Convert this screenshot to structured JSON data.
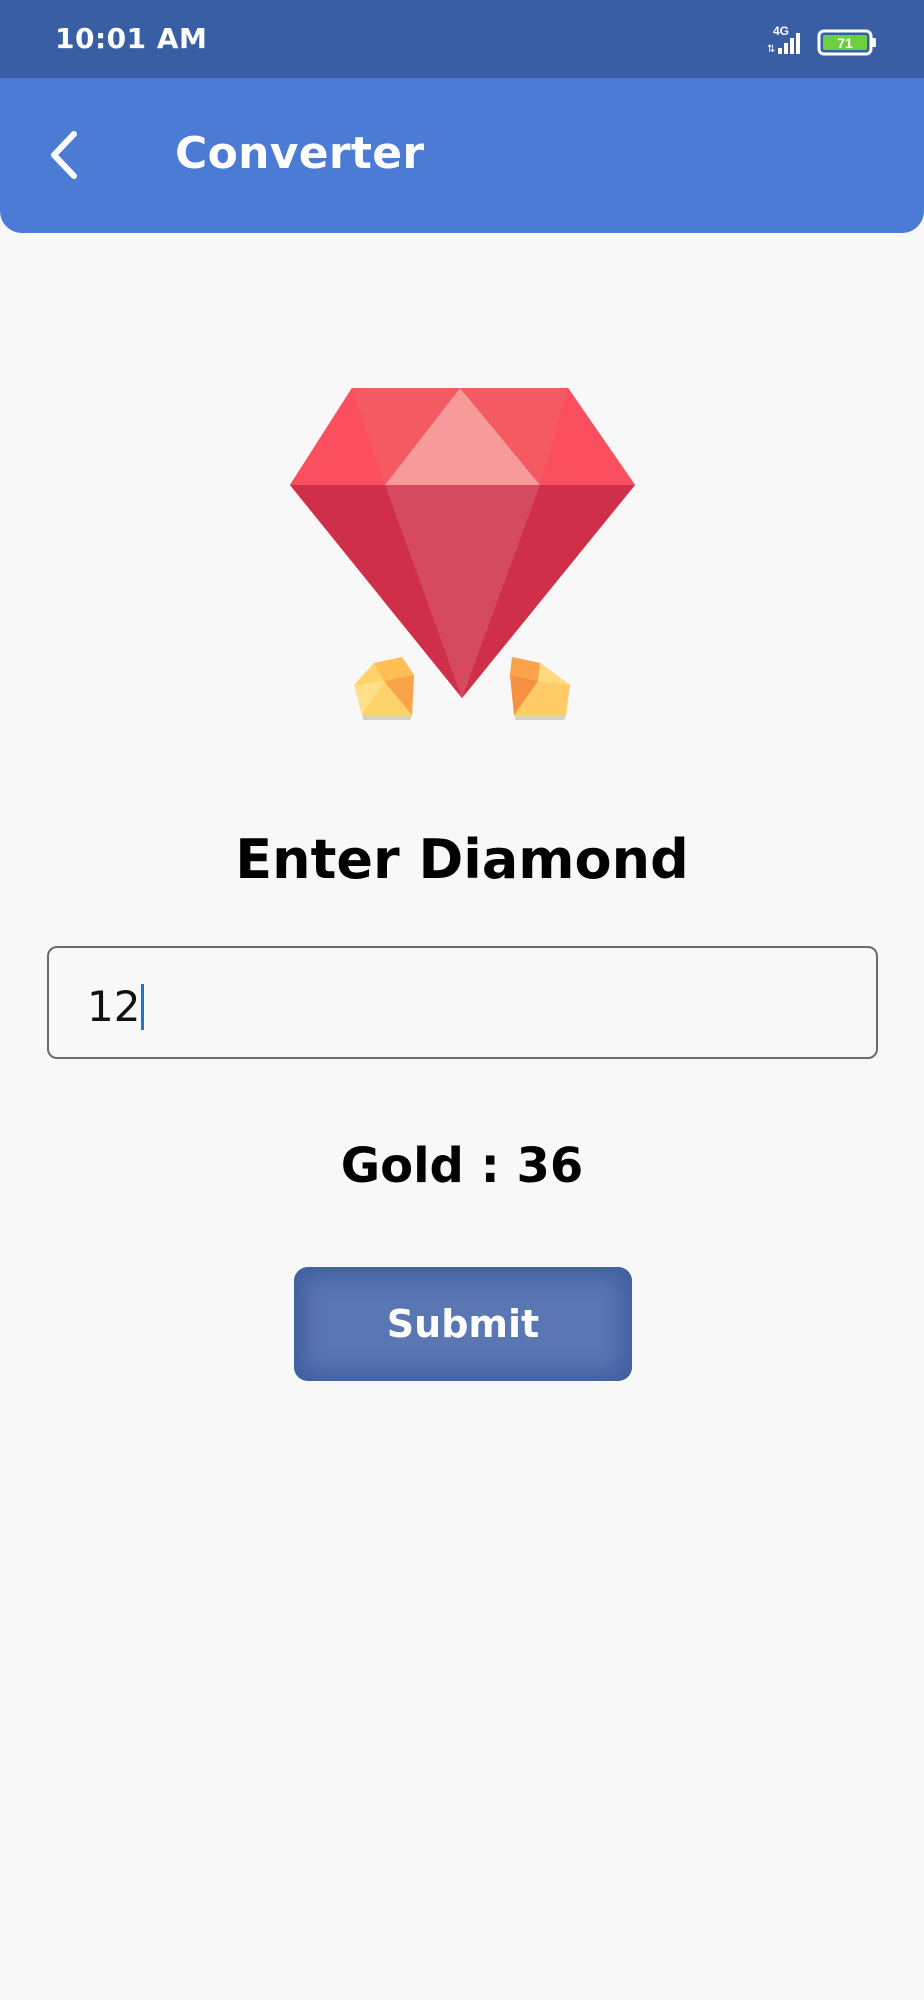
{
  "status_bar": {
    "time": "10:01 AM",
    "network": "4G",
    "battery": "71",
    "background": "#3a5ea3"
  },
  "app_bar": {
    "title": "Converter",
    "back_icon": "chevron-left-icon",
    "background": "#4b7bd5"
  },
  "illustration": {
    "icon": "ruby-gem-icon"
  },
  "form": {
    "prompt": "Enter Diamond",
    "input_value": "12",
    "result_label": "Gold",
    "result_separator": " : ",
    "result_value": "36",
    "submit_label": "Submit"
  },
  "colors": {
    "button": "#5a76b3",
    "caret": "#1976d2",
    "gem_red": "#e2394f"
  }
}
